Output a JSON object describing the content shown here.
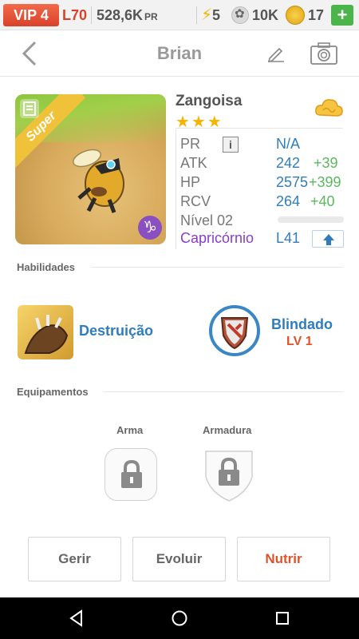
{
  "status": {
    "vip": "VIP 4",
    "level": "L70",
    "pr": "528,6K",
    "pr_unit": "PR",
    "energy": "5",
    "paws": "10K",
    "coins": "17",
    "plus": "+"
  },
  "header": {
    "title": "Brian"
  },
  "monster": {
    "ribbon": "Super",
    "name": "Zangoisa",
    "stars": "★★★",
    "stats": {
      "pr_label": "PR",
      "pr_value": "N/A",
      "atk_label": "ATK",
      "atk_value": "242",
      "atk_bonus": "+39",
      "hp_label": "HP",
      "hp_value": "2575",
      "hp_bonus": "+399",
      "rcv_label": "RCV",
      "rcv_value": "264",
      "rcv_bonus": "+40",
      "level_label": "Nível 02",
      "level_progress": 0,
      "sign_label": "Capricórnio",
      "sign_level": "L41"
    }
  },
  "skills": {
    "section_label": "Habilidades",
    "active_name": "Destruição",
    "passive_name": "Blindado",
    "passive_level": "LV 1"
  },
  "equipment": {
    "section_label": "Equipamentos",
    "weapon_label": "Arma",
    "armor_label": "Armadura"
  },
  "actions": {
    "manage": "Gerir",
    "evolve": "Evoluir",
    "feed": "Nutrir"
  },
  "colors": {
    "accent_blue": "#2f7dbd",
    "accent_red": "#e0522a",
    "bonus_green": "#5cb85c",
    "sign_purple": "#8a3cc7"
  }
}
